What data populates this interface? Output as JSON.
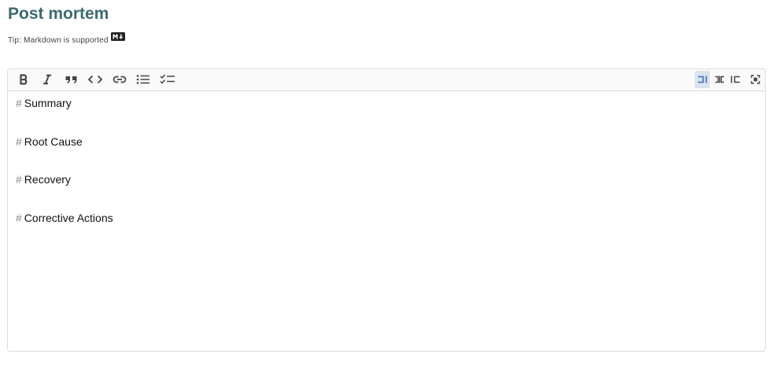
{
  "title": "Post mortem",
  "tip": {
    "text": "Tip: Markdown is supported",
    "badge_icon": "markdown-icon"
  },
  "toolbar": {
    "left_buttons": [
      {
        "name": "bold-button",
        "icon": "bold-icon"
      },
      {
        "name": "italic-button",
        "icon": "italic-icon"
      },
      {
        "name": "quote-button",
        "icon": "quote-icon"
      },
      {
        "name": "code-button",
        "icon": "code-icon"
      },
      {
        "name": "link-button",
        "icon": "link-icon"
      },
      {
        "name": "bullet-list-button",
        "icon": "bullet-list-icon"
      },
      {
        "name": "task-list-button",
        "icon": "task-list-icon"
      }
    ],
    "right_buttons": [
      {
        "name": "edit-only-button",
        "icon": "edit-only-icon",
        "active": true
      },
      {
        "name": "split-view-button",
        "icon": "split-view-icon",
        "active": false
      },
      {
        "name": "preview-only-button",
        "icon": "preview-only-icon",
        "active": false
      },
      {
        "name": "fullscreen-button",
        "icon": "fullscreen-icon",
        "active": false
      }
    ]
  },
  "editor": {
    "lines": [
      {
        "marker": "#",
        "text": "Summary"
      },
      {
        "marker": "",
        "text": ""
      },
      {
        "marker": "#",
        "text": "Root Cause"
      },
      {
        "marker": "",
        "text": ""
      },
      {
        "marker": "#",
        "text": "Recovery"
      },
      {
        "marker": "",
        "text": ""
      },
      {
        "marker": "#",
        "text": "Corrective Actions"
      }
    ]
  },
  "colors": {
    "title": "#3c6b6e",
    "icon": "#444444",
    "active_bg": "#dbe3ef",
    "active_icon": "#3b6fb6",
    "border": "#dcdcdc"
  }
}
